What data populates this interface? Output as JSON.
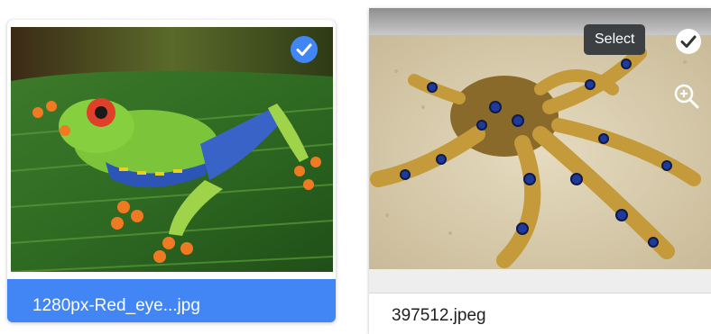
{
  "cards": [
    {
      "filename": "1280px-Red_eye...jpg",
      "image": "red-eyed tree frog photo",
      "state": "selected"
    },
    {
      "filename": "397512.jpeg",
      "image": "blue-ringed octopus photo",
      "state": "hover"
    }
  ],
  "hover_controls": {
    "select_tooltip": "Select"
  },
  "colors": {
    "selected_bg": "#4285f4",
    "tooltip_bg": "#3c4043"
  },
  "icons": [
    "check-circle-icon",
    "zoom-in-icon"
  ]
}
